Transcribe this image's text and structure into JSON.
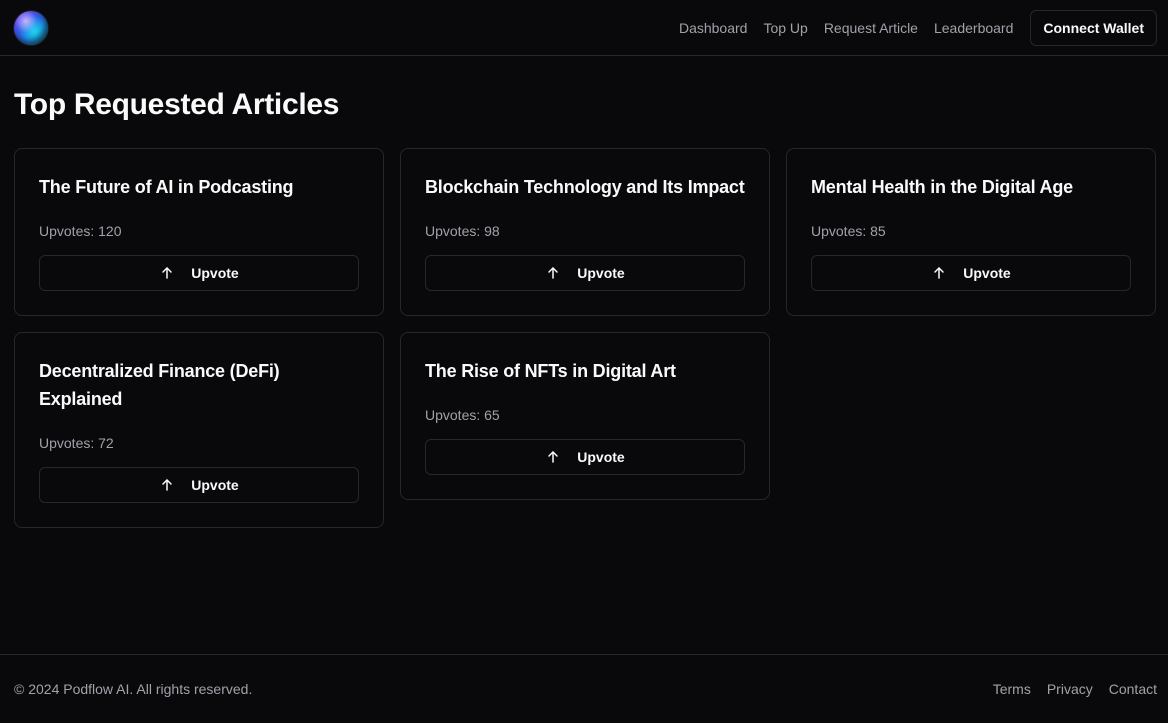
{
  "header": {
    "logo_icon": "gradient-orb-logo",
    "nav": [
      {
        "label": "Dashboard"
      },
      {
        "label": "Top Up"
      },
      {
        "label": "Request Article"
      },
      {
        "label": "Leaderboard"
      }
    ],
    "connect_wallet_label": "Connect Wallet"
  },
  "main": {
    "title": "Top Requested Articles",
    "upvote_icon": "arrow-up-icon",
    "articles": [
      {
        "title": "The Future of AI in Podcasting",
        "upvotes": "Upvotes: 120",
        "button_label": "Upvote"
      },
      {
        "title": "Blockchain Technology and Its Impact",
        "upvotes": "Upvotes: 98",
        "button_label": "Upvote"
      },
      {
        "title": "Mental Health in the Digital Age",
        "upvotes": "Upvotes: 85",
        "button_label": "Upvote"
      },
      {
        "title": "Decentralized Finance (DeFi) Explained",
        "upvotes": "Upvotes: 72",
        "button_label": "Upvote"
      },
      {
        "title": "The Rise of NFTs in Digital Art",
        "upvotes": "Upvotes: 65",
        "button_label": "Upvote"
      }
    ]
  },
  "footer": {
    "copyright": "© 2024 Podflow AI. All rights reserved.",
    "links": [
      {
        "label": "Terms"
      },
      {
        "label": "Privacy"
      },
      {
        "label": "Contact"
      }
    ]
  },
  "colors": {
    "background": "#09090b",
    "border": "#27272a",
    "text": "#fafafa",
    "muted_text": "#a1a1aa"
  }
}
